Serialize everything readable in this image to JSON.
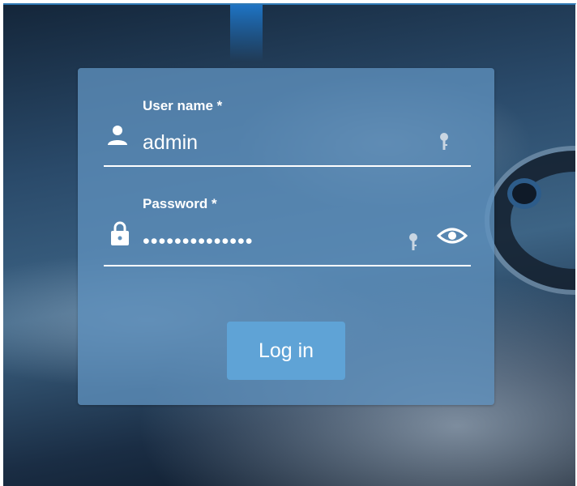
{
  "login": {
    "username": {
      "label": "User name *",
      "value": "admin",
      "icon": "person-icon",
      "adornment_icon": "key-icon"
    },
    "password": {
      "label": "Password *",
      "value": "••••••••••••••",
      "icon": "lock-icon",
      "adornment_icon": "key-icon",
      "toggle_icon": "eye-icon"
    },
    "submit_label": "Log in"
  },
  "colors": {
    "card": "#5f91be",
    "button": "#5fa3d6",
    "text": "#ffffff",
    "frame_border": "#2f79b5"
  }
}
